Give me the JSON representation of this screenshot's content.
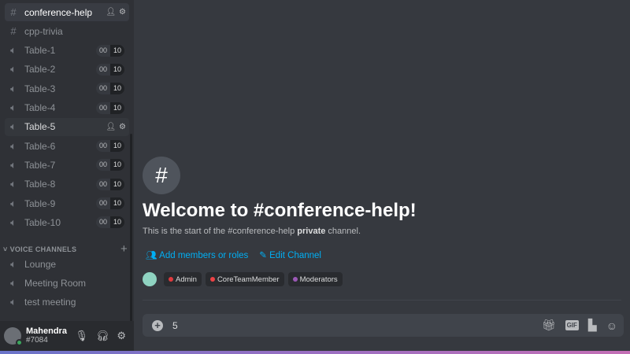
{
  "sidebar": {
    "channels": [
      {
        "label": "conference-help",
        "type": "text",
        "state": "active"
      },
      {
        "label": "cpp-trivia",
        "type": "text"
      },
      {
        "label": "Table-1",
        "type": "voice",
        "users": "00",
        "limit": "10"
      },
      {
        "label": "Table-2",
        "type": "voice",
        "users": "00",
        "limit": "10"
      },
      {
        "label": "Table-3",
        "type": "voice",
        "users": "00",
        "limit": "10"
      },
      {
        "label": "Table-4",
        "type": "voice",
        "users": "00",
        "limit": "10"
      },
      {
        "label": "Table-5",
        "type": "voice",
        "state": "hover"
      },
      {
        "label": "Table-6",
        "type": "voice",
        "users": "00",
        "limit": "10"
      },
      {
        "label": "Table-7",
        "type": "voice",
        "users": "00",
        "limit": "10"
      },
      {
        "label": "Table-8",
        "type": "voice",
        "users": "00",
        "limit": "10"
      },
      {
        "label": "Table-9",
        "type": "voice",
        "users": "00",
        "limit": "10"
      },
      {
        "label": "Table-10",
        "type": "voice",
        "users": "00",
        "limit": "10"
      }
    ],
    "voice_header": "VOICE CHANNELS",
    "voice_channels": [
      {
        "label": "Lounge"
      },
      {
        "label": "Meeting Room"
      },
      {
        "label": "test meeting"
      }
    ]
  },
  "user": {
    "name": "Mahendra",
    "tag": "#7084",
    "status_color": "#3ba55d"
  },
  "main": {
    "title": "Welcome to #conference-help!",
    "sub_pre": "This is the start of the #conference-help ",
    "sub_bold": "private",
    "sub_post": " channel.",
    "add_members": "Add members or roles",
    "edit_channel": "Edit Channel",
    "roles": [
      {
        "name": "Admin",
        "color": "#e03a3e"
      },
      {
        "name": "CoreTeamMember",
        "color": "#ed4245"
      },
      {
        "name": "Moderators",
        "color": "#9b59b6"
      }
    ]
  },
  "input": {
    "value": "5",
    "gif_label": "GIF"
  }
}
